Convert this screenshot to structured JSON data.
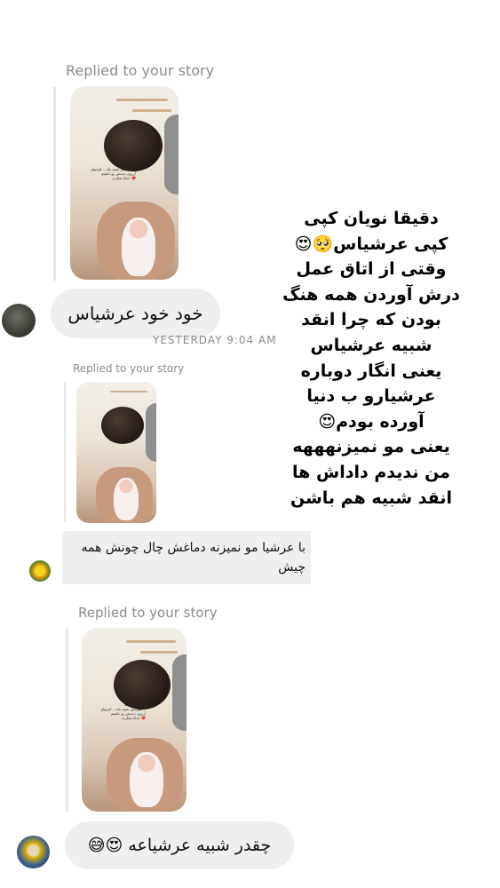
{
  "threads": [
    {
      "replied_label": "Replied to your story",
      "reply_text": "خود خود عرشیاس"
    },
    {
      "timestamp": "YESTERDAY 9:04 AM",
      "replied_label": "Replied to your story",
      "reply_text": "با عرشیا مو نمیزنه دماغش چال چونش همه چیش"
    },
    {
      "replied_label": "Replied to your story",
      "reply_text": "چقدر شبیه عرشیاعه 😍😅"
    }
  ],
  "story_caption": "انقد گوگولیه...\nصورتش شبیه ماه... کوچولو...\nآرزوی دیدنش رو داشتم\nخدایا شکرت ❤️",
  "overlay_lines": [
    "دقیقا نویان کپی",
    "کپی عرشیاس🥺😍",
    "وقتی از اتاق عمل",
    "درش آوردن همه هنگ",
    "بودن که چرا انقد",
    "شبیه عرشیاس",
    "یعنی انگار دوباره",
    "عرشیارو ب دنیا",
    "آورده بودم😍",
    "یعنی مو نمیزنهههه",
    "من ندیدم داداش ها",
    "انقد شبیه هم باشن"
  ],
  "colors": {
    "bubble_bg": "#efefef",
    "secondary_text": "#8b8b8b"
  }
}
